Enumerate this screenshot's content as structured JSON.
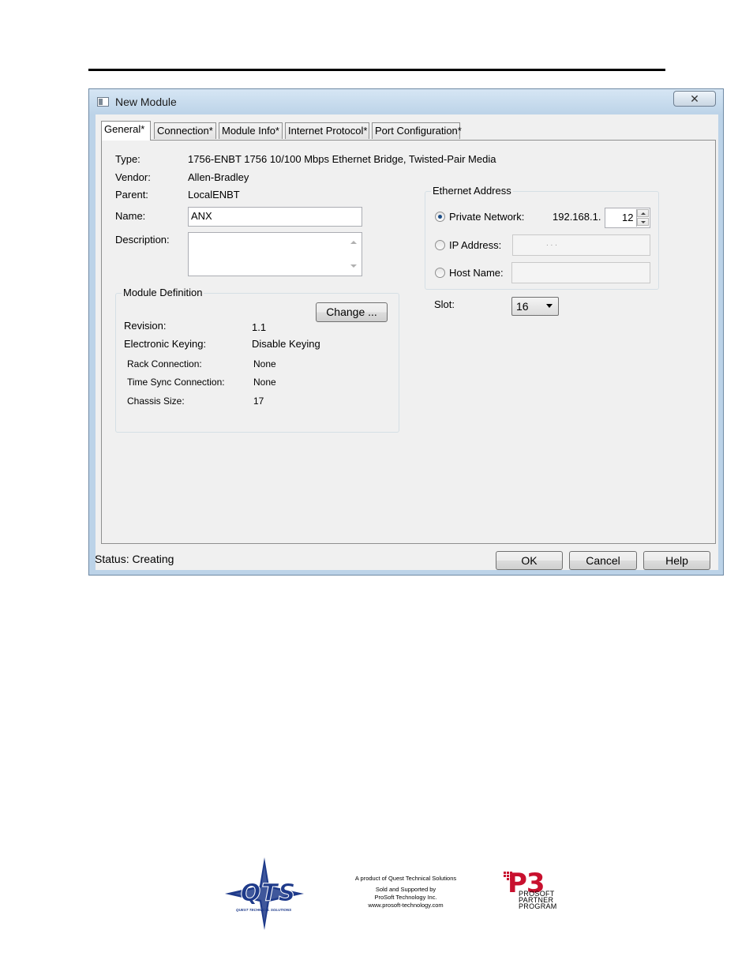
{
  "window": {
    "title": "New Module",
    "close_glyph": "✕"
  },
  "tabs": [
    {
      "label": "General*"
    },
    {
      "label": "Connection*"
    },
    {
      "label": "Module Info*"
    },
    {
      "label": "Internet Protocol*"
    },
    {
      "label": "Port Configuration*"
    }
  ],
  "general": {
    "type_label": "Type:",
    "type_value": "1756-ENBT 1756 10/100 Mbps Ethernet Bridge, Twisted-Pair Media",
    "vendor_label": "Vendor:",
    "vendor_value": "Allen-Bradley",
    "parent_label": "Parent:",
    "parent_value": "LocalENBT",
    "name_label": "Name:",
    "name_value": "ANX",
    "description_label": "Description:",
    "description_value": ""
  },
  "module_definition": {
    "title": "Module Definition",
    "change_button": "Change ...",
    "revision_label": "Revision:",
    "revision_value": "1.1",
    "keying_label": "Electronic Keying:",
    "keying_value": "Disable Keying",
    "rack_label": "Rack Connection:",
    "rack_value": "None",
    "timesync_label": "Time Sync Connection:",
    "timesync_value": "None",
    "chassis_label": "Chassis Size:",
    "chassis_value": "17"
  },
  "ethernet": {
    "title": "Ethernet Address",
    "private_label": "Private Network:",
    "private_prefix": "192.168.1.",
    "private_value": "12",
    "ip_label": "IP Address:",
    "ip_dots": ".           .           .",
    "host_label": "Host Name:",
    "selected": "private"
  },
  "slot": {
    "label": "Slot:",
    "value": "16"
  },
  "status": {
    "text": "Status:  Creating"
  },
  "buttons": {
    "ok": "OK",
    "cancel": "Cancel",
    "help": "Help"
  },
  "footer": {
    "qts_logo_text": "QTS",
    "qts_tagline": "QUEST TECHNICAL SOLUTIONS",
    "line1": "A product of Quest Technical Solutions",
    "line2": "Sold and Supported by",
    "line3": "ProSoft Technology Inc.",
    "line4": "www.prosoft-technology.com",
    "p3_mark": "P3",
    "p3_line1": "PROSOFT",
    "p3_line2": "PARTNER",
    "p3_line3": "PROGRAM"
  },
  "colors": {
    "window_frame": "#bcd3e8",
    "dialog_bg": "#f0f0f0",
    "qts_blue": "#1e3a8a",
    "p3_red": "#c8102e"
  }
}
